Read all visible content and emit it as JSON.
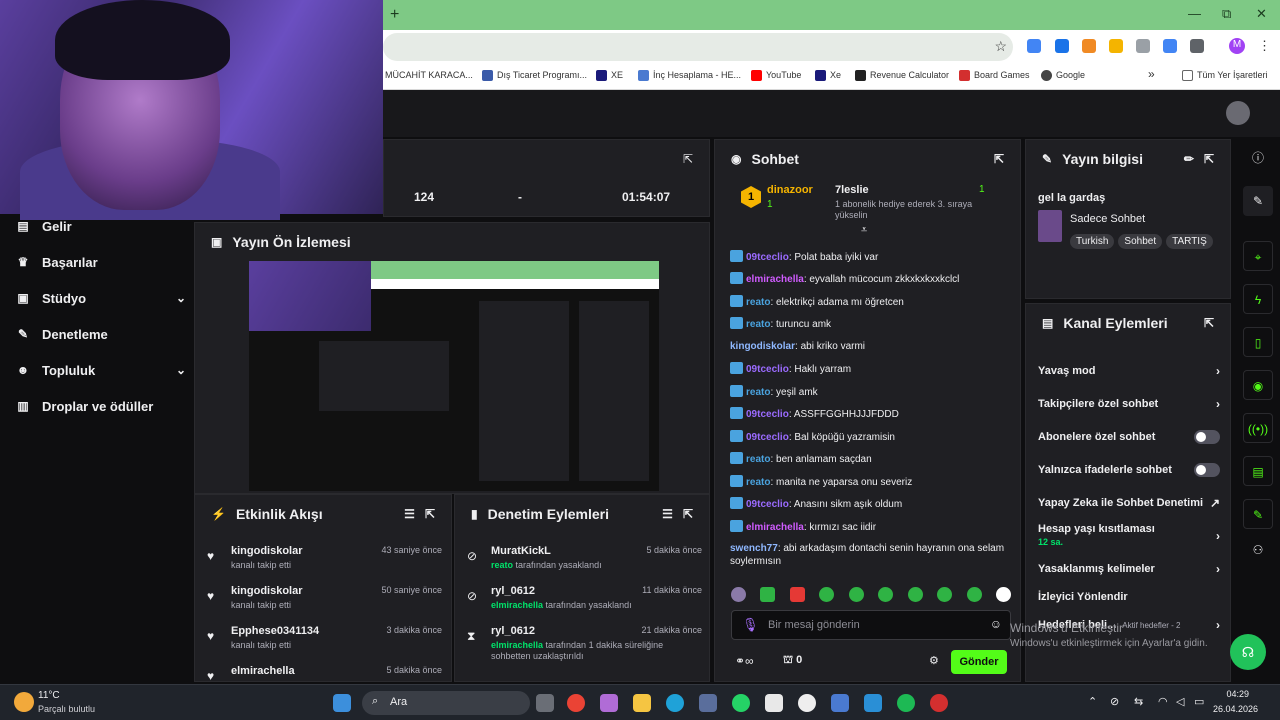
{
  "browser": {
    "new_tab": "+",
    "bookmarks": [
      "MÜCAHİT KARACA...",
      "Dış Ticaret Programı...",
      "XE",
      "İnç Hesaplama - HE...",
      "YouTube",
      "Xe",
      "Revenue Calculator",
      "Board Games",
      "Google"
    ],
    "more_bookmarks": "»",
    "all_bookmarks": "Tüm Yer İşaretleri",
    "profile_letter": "M",
    "window_minimize": "—",
    "window_restore": "⧉",
    "window_close": "✕"
  },
  "stats": {
    "viewers": "124",
    "followers": "-",
    "duration": "01:54:07"
  },
  "nav": {
    "items": [
      {
        "label": "Gelir",
        "icon": "chart-icon"
      },
      {
        "label": "Başarılar",
        "icon": "trophy-icon"
      },
      {
        "label": "Stüdyo",
        "icon": "studio-icon"
      },
      {
        "label": "Denetleme",
        "icon": "wrench-icon"
      },
      {
        "label": "Topluluk",
        "icon": "community-icon"
      },
      {
        "label": "Droplar ve ödüller",
        "icon": "gift-icon"
      }
    ]
  },
  "preview": {
    "title": "Yayın Ön İzlemesi"
  },
  "activity": {
    "title": "Etkinlik Akışı",
    "items": [
      {
        "name": "kingodiskolar",
        "sub": "kanalı takip etti",
        "time": "43 saniye önce"
      },
      {
        "name": "kingodiskolar",
        "sub": "kanalı takip etti",
        "time": "50 saniye önce"
      },
      {
        "name": "Epphese0341134",
        "sub": "kanalı takip etti",
        "time": "3 dakika önce"
      },
      {
        "name": "elmirachella",
        "sub": "",
        "time": "5 dakika önce"
      }
    ]
  },
  "moderation": {
    "title": "Denetim Eylemleri",
    "items": [
      {
        "name": "MuratKickL",
        "by": "reato",
        "sub": " tarafından yasaklandı",
        "time": "5 dakika önce"
      },
      {
        "name": "ryl_0612",
        "by": "elmirachella",
        "sub": " tarafından yasaklandı",
        "time": "11 dakika önce"
      },
      {
        "name": "ryl_0612",
        "by": "elmirachella",
        "sub": " tarafından 1 dakika süreliğine sohbetten uzaklaştırıldı",
        "time": "21 dakika önce"
      }
    ]
  },
  "chat": {
    "title": "Sohbet",
    "top1_name": "dinazoor",
    "top1_rank": "1",
    "top1_count": "1",
    "top2_name": "7leslie",
    "top2_count": "1",
    "gift_note": "1 abonelik hediye ederek 3. sıraya yükselin",
    "messages": [
      {
        "user": "09tceclio",
        "color": "#9b6bff",
        "text": ": Polat baba iyiki var"
      },
      {
        "user": "elmirachella",
        "color": "#d05cff",
        "text": ": eyvallah mücocum zkkxkxkxxkclcl"
      },
      {
        "user": "reato",
        "color": "#4aa3df",
        "text": ": elektrikçi adama mı öğretcen"
      },
      {
        "user": "reato",
        "color": "#4aa3df",
        "text": ": turuncu amk"
      },
      {
        "user": "kingodiskolar",
        "color": "#8fb8ff",
        "text": ": abi kriko varmi"
      },
      {
        "user": "09tceclio",
        "color": "#9b6bff",
        "text": ": Haklı yarram"
      },
      {
        "user": "reato",
        "color": "#4aa3df",
        "text": ": yeşil amk"
      },
      {
        "user": "09tceclio",
        "color": "#9b6bff",
        "text": ": ASSFFGGHHJJJFDDD"
      },
      {
        "user": "09tceclio",
        "color": "#9b6bff",
        "text": ": Bal köpüğü yazramisin"
      },
      {
        "user": "reato",
        "color": "#4aa3df",
        "text": ": ben anlamam saçdan"
      },
      {
        "user": "reato",
        "color": "#4aa3df",
        "text": ": manita ne yaparsa onu severiz"
      },
      {
        "user": "09tceclio",
        "color": "#9b6bff",
        "text": ": Anasını sikm aşık oldum"
      },
      {
        "user": "elmirachella",
        "color": "#d05cff",
        "text": ": kırmızı sac iidir"
      },
      {
        "user": "swench77",
        "color": "#8fb8ff",
        "text": ": abi arkadaşım dontachi senin hayranın ona selam soylermısın"
      }
    ],
    "placeholder": "Bir mesaj gönderin",
    "send": "Gönder",
    "count": "0"
  },
  "info": {
    "title": "Yayın bilgisi",
    "stream_title": "gel la gardaş",
    "category": "Sadece Sohbet",
    "tags": [
      "Turkish",
      "Sohbet",
      "TARTIŞ"
    ]
  },
  "actions": {
    "title": "Kanal Eylemleri",
    "items": [
      {
        "label": "Yavaş mod",
        "type": "arrow"
      },
      {
        "label": "Takipçilere özel sohbet",
        "type": "arrow"
      },
      {
        "label": "Abonelere özel sohbet",
        "type": "toggle"
      },
      {
        "label": "Yalnızca ifadelerle sohbet",
        "type": "toggle"
      },
      {
        "label": "Yapay Zeka ile Sohbet Denetimi",
        "type": "external"
      },
      {
        "label": "Hesap yaşı kısıtlaması",
        "type": "arrow",
        "sub": "12 sa."
      },
      {
        "label": "Yasaklanmış kelimeler",
        "type": "arrow"
      },
      {
        "label": "İzleyici Yönlendir",
        "type": "none"
      },
      {
        "label": "Hedefleri beli...",
        "type": "arrow",
        "extra": "Aktif hedefler - 2"
      }
    ]
  },
  "watermark": {
    "line1": "Windows'u Etkinleştir",
    "line2": "Windows'u etkinleştirmek için Ayarlar'a gidin."
  },
  "taskbar": {
    "weather_temp": "11°C",
    "weather_desc": "Parçalı bulutlu",
    "search": "Ara",
    "time": "04:29",
    "date": "26.04.2026"
  },
  "colors": {
    "accent": "#53fc18",
    "panel": "#1f1f23",
    "bg": "#0e0e10"
  }
}
